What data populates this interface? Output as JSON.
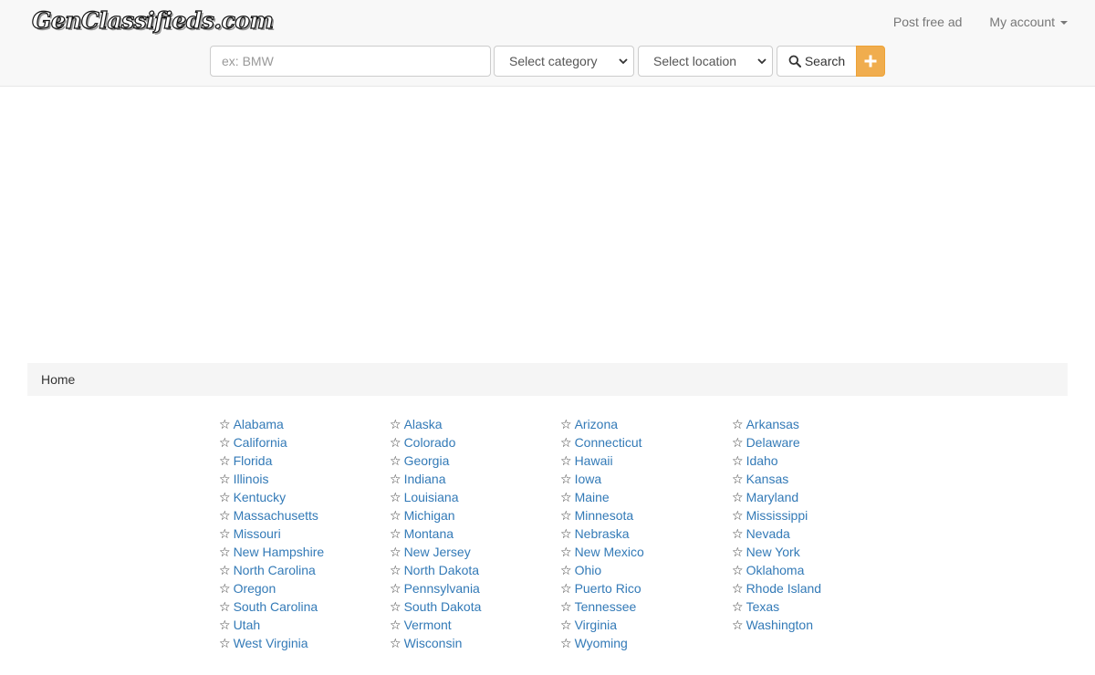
{
  "header": {
    "logo_text": "GenClassifieds.com",
    "nav": {
      "post_free_ad": "Post free ad",
      "my_account": "My account"
    }
  },
  "search": {
    "placeholder": "ex: BMW",
    "category_select": "Select category",
    "location_select": "Select location",
    "search_button": "Search",
    "add_button_icon": "plus-icon"
  },
  "breadcrumb": {
    "home": "Home"
  },
  "colors": {
    "link": "#337ab7",
    "add_button": "#f0ad4e",
    "navbar_bg": "#f8f8f8",
    "breadcrumb_bg": "#f5f5f5"
  },
  "states": [
    "Alabama",
    "Alaska",
    "Arizona",
    "Arkansas",
    "California",
    "Colorado",
    "Connecticut",
    "Delaware",
    "Florida",
    "Georgia",
    "Hawaii",
    "Idaho",
    "Illinois",
    "Indiana",
    "Iowa",
    "Kansas",
    "Kentucky",
    "Louisiana",
    "Maine",
    "Maryland",
    "Massachusetts",
    "Michigan",
    "Minnesota",
    "Mississippi",
    "Missouri",
    "Montana",
    "Nebraska",
    "Nevada",
    "New Hampshire",
    "New Jersey",
    "New Mexico",
    "New York",
    "North Carolina",
    "North Dakota",
    "Ohio",
    "Oklahoma",
    "Oregon",
    "Pennsylvania",
    "Puerto Rico",
    "Rhode Island",
    "South Carolina",
    "South Dakota",
    "Tennessee",
    "Texas",
    "Utah",
    "Vermont",
    "Virginia",
    "Washington",
    "West Virginia",
    "Wisconsin",
    "Wyoming"
  ],
  "state_icon": "star-outline-icon"
}
